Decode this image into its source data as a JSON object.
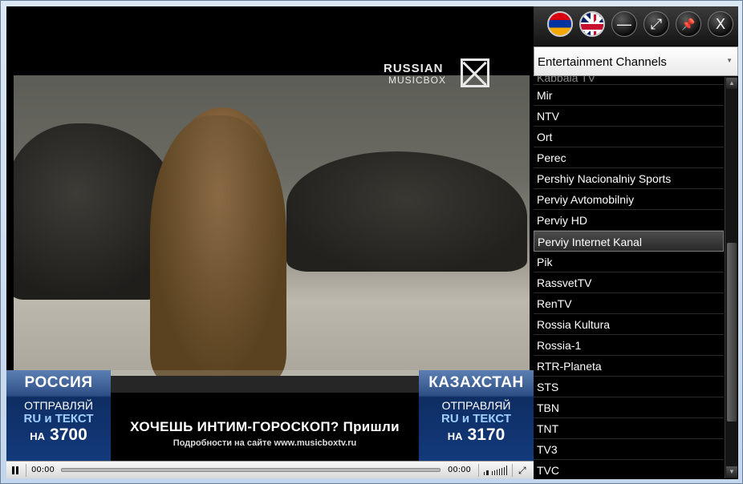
{
  "video": {
    "logo_line1": "RUSSIAN",
    "logo_line2": "MUSICBOX",
    "ticker": {
      "left_country": "РОССИЯ",
      "left_send": "ОТПРАВЛЯЙ",
      "left_code": "RU и ТЕКСТ",
      "left_prefix": "НА",
      "left_number": "3700",
      "right_country": "КАЗАХСТАН",
      "right_send": "ОТПРАВЛЯЙ",
      "right_code": "RU и ТЕКСТ",
      "right_prefix": "НА",
      "right_number": "3170",
      "promo": "ХОЧЕШЬ ИНТИМ-ГОРОСКОП? Пришли",
      "promo_sub": "Подробности на сайте www.musicboxtv.ru"
    }
  },
  "controls": {
    "time_elapsed": "00:00",
    "time_total": "00:00",
    "icons": [
      "pause-icon",
      "volume-icon",
      "fullscreen-icon"
    ]
  },
  "toolbar": {
    "buttons": [
      "armenian-flag-icon",
      "uk-flag-icon",
      "minimize-icon",
      "fullscreen-expand-icon",
      "pin-icon",
      "close-icon"
    ],
    "minimize_glyph": "—",
    "expand_glyph": "⤢",
    "pin_glyph": "📌",
    "close_glyph": "X"
  },
  "category": {
    "selected": "Entertainment Channels"
  },
  "channels": {
    "partial_top": "Kabbala TV",
    "items": [
      "Mir",
      "NTV",
      "Ort",
      "Perec",
      "Pershiy Nacionalniy Sports",
      "Perviy Avtomobilniy",
      "Perviy HD",
      "Perviy Internet Kanal",
      "Pik",
      "RassvetTV",
      "RenTV",
      "Rossia Kultura",
      "Rossia-1",
      "RTR-Planeta",
      "STS",
      "TBN",
      "TNT",
      "TV3",
      "TVC"
    ],
    "selected_index": 7
  },
  "colors": {
    "panel_bg": "#000000",
    "ticker_blue": "#133a7b",
    "window_frame": "#cfe0f1"
  }
}
